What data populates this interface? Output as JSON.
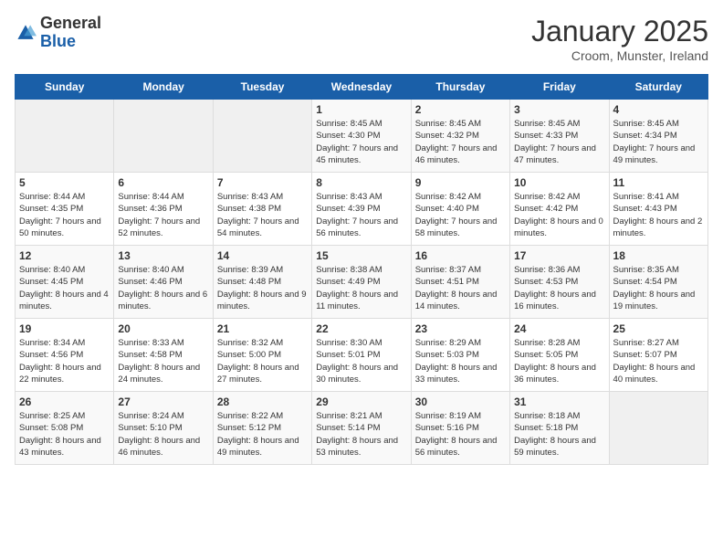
{
  "header": {
    "logo_general": "General",
    "logo_blue": "Blue",
    "month": "January 2025",
    "location": "Croom, Munster, Ireland"
  },
  "days_of_week": [
    "Sunday",
    "Monday",
    "Tuesday",
    "Wednesday",
    "Thursday",
    "Friday",
    "Saturday"
  ],
  "weeks": [
    [
      {
        "day": "",
        "empty": true
      },
      {
        "day": "",
        "empty": true
      },
      {
        "day": "",
        "empty": true
      },
      {
        "day": "1",
        "sunrise": "Sunrise: 8:45 AM",
        "sunset": "Sunset: 4:30 PM",
        "daylight": "Daylight: 7 hours and 45 minutes."
      },
      {
        "day": "2",
        "sunrise": "Sunrise: 8:45 AM",
        "sunset": "Sunset: 4:32 PM",
        "daylight": "Daylight: 7 hours and 46 minutes."
      },
      {
        "day": "3",
        "sunrise": "Sunrise: 8:45 AM",
        "sunset": "Sunset: 4:33 PM",
        "daylight": "Daylight: 7 hours and 47 minutes."
      },
      {
        "day": "4",
        "sunrise": "Sunrise: 8:45 AM",
        "sunset": "Sunset: 4:34 PM",
        "daylight": "Daylight: 7 hours and 49 minutes."
      }
    ],
    [
      {
        "day": "5",
        "sunrise": "Sunrise: 8:44 AM",
        "sunset": "Sunset: 4:35 PM",
        "daylight": "Daylight: 7 hours and 50 minutes."
      },
      {
        "day": "6",
        "sunrise": "Sunrise: 8:44 AM",
        "sunset": "Sunset: 4:36 PM",
        "daylight": "Daylight: 7 hours and 52 minutes."
      },
      {
        "day": "7",
        "sunrise": "Sunrise: 8:43 AM",
        "sunset": "Sunset: 4:38 PM",
        "daylight": "Daylight: 7 hours and 54 minutes."
      },
      {
        "day": "8",
        "sunrise": "Sunrise: 8:43 AM",
        "sunset": "Sunset: 4:39 PM",
        "daylight": "Daylight: 7 hours and 56 minutes."
      },
      {
        "day": "9",
        "sunrise": "Sunrise: 8:42 AM",
        "sunset": "Sunset: 4:40 PM",
        "daylight": "Daylight: 7 hours and 58 minutes."
      },
      {
        "day": "10",
        "sunrise": "Sunrise: 8:42 AM",
        "sunset": "Sunset: 4:42 PM",
        "daylight": "Daylight: 8 hours and 0 minutes."
      },
      {
        "day": "11",
        "sunrise": "Sunrise: 8:41 AM",
        "sunset": "Sunset: 4:43 PM",
        "daylight": "Daylight: 8 hours and 2 minutes."
      }
    ],
    [
      {
        "day": "12",
        "sunrise": "Sunrise: 8:40 AM",
        "sunset": "Sunset: 4:45 PM",
        "daylight": "Daylight: 8 hours and 4 minutes."
      },
      {
        "day": "13",
        "sunrise": "Sunrise: 8:40 AM",
        "sunset": "Sunset: 4:46 PM",
        "daylight": "Daylight: 8 hours and 6 minutes."
      },
      {
        "day": "14",
        "sunrise": "Sunrise: 8:39 AM",
        "sunset": "Sunset: 4:48 PM",
        "daylight": "Daylight: 8 hours and 9 minutes."
      },
      {
        "day": "15",
        "sunrise": "Sunrise: 8:38 AM",
        "sunset": "Sunset: 4:49 PM",
        "daylight": "Daylight: 8 hours and 11 minutes."
      },
      {
        "day": "16",
        "sunrise": "Sunrise: 8:37 AM",
        "sunset": "Sunset: 4:51 PM",
        "daylight": "Daylight: 8 hours and 14 minutes."
      },
      {
        "day": "17",
        "sunrise": "Sunrise: 8:36 AM",
        "sunset": "Sunset: 4:53 PM",
        "daylight": "Daylight: 8 hours and 16 minutes."
      },
      {
        "day": "18",
        "sunrise": "Sunrise: 8:35 AM",
        "sunset": "Sunset: 4:54 PM",
        "daylight": "Daylight: 8 hours and 19 minutes."
      }
    ],
    [
      {
        "day": "19",
        "sunrise": "Sunrise: 8:34 AM",
        "sunset": "Sunset: 4:56 PM",
        "daylight": "Daylight: 8 hours and 22 minutes."
      },
      {
        "day": "20",
        "sunrise": "Sunrise: 8:33 AM",
        "sunset": "Sunset: 4:58 PM",
        "daylight": "Daylight: 8 hours and 24 minutes."
      },
      {
        "day": "21",
        "sunrise": "Sunrise: 8:32 AM",
        "sunset": "Sunset: 5:00 PM",
        "daylight": "Daylight: 8 hours and 27 minutes."
      },
      {
        "day": "22",
        "sunrise": "Sunrise: 8:30 AM",
        "sunset": "Sunset: 5:01 PM",
        "daylight": "Daylight: 8 hours and 30 minutes."
      },
      {
        "day": "23",
        "sunrise": "Sunrise: 8:29 AM",
        "sunset": "Sunset: 5:03 PM",
        "daylight": "Daylight: 8 hours and 33 minutes."
      },
      {
        "day": "24",
        "sunrise": "Sunrise: 8:28 AM",
        "sunset": "Sunset: 5:05 PM",
        "daylight": "Daylight: 8 hours and 36 minutes."
      },
      {
        "day": "25",
        "sunrise": "Sunrise: 8:27 AM",
        "sunset": "Sunset: 5:07 PM",
        "daylight": "Daylight: 8 hours and 40 minutes."
      }
    ],
    [
      {
        "day": "26",
        "sunrise": "Sunrise: 8:25 AM",
        "sunset": "Sunset: 5:08 PM",
        "daylight": "Daylight: 8 hours and 43 minutes."
      },
      {
        "day": "27",
        "sunrise": "Sunrise: 8:24 AM",
        "sunset": "Sunset: 5:10 PM",
        "daylight": "Daylight: 8 hours and 46 minutes."
      },
      {
        "day": "28",
        "sunrise": "Sunrise: 8:22 AM",
        "sunset": "Sunset: 5:12 PM",
        "daylight": "Daylight: 8 hours and 49 minutes."
      },
      {
        "day": "29",
        "sunrise": "Sunrise: 8:21 AM",
        "sunset": "Sunset: 5:14 PM",
        "daylight": "Daylight: 8 hours and 53 minutes."
      },
      {
        "day": "30",
        "sunrise": "Sunrise: 8:19 AM",
        "sunset": "Sunset: 5:16 PM",
        "daylight": "Daylight: 8 hours and 56 minutes."
      },
      {
        "day": "31",
        "sunrise": "Sunrise: 8:18 AM",
        "sunset": "Sunset: 5:18 PM",
        "daylight": "Daylight: 8 hours and 59 minutes."
      },
      {
        "day": "",
        "empty": true
      }
    ]
  ]
}
